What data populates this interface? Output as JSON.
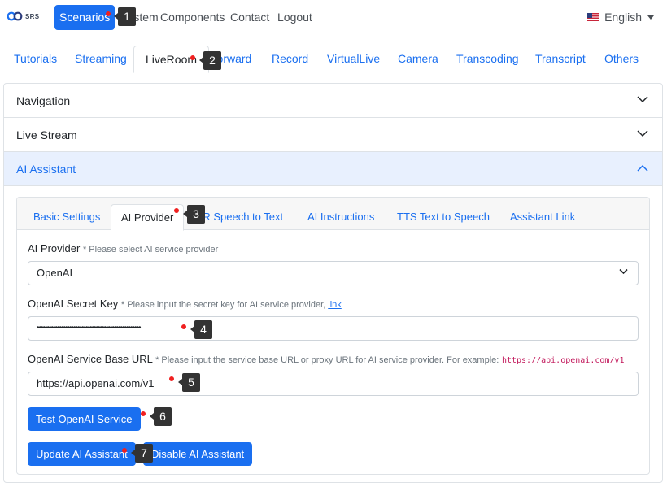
{
  "brand": {
    "text": "SRS",
    "icon": "srs-logo-icon"
  },
  "topnav": {
    "active_label": "Scenarios",
    "links": [
      "System",
      "Components",
      "Contact",
      "Logout"
    ],
    "language": "English",
    "language_icon": "us-flag-icon"
  },
  "main_tabs": [
    "Tutorials",
    "Streaming",
    "LiveRoom",
    "Forward",
    "Record",
    "VirtualLive",
    "Camera",
    "Transcoding",
    "Transcript",
    "Others"
  ],
  "main_tab_active": "LiveRoom",
  "accordion": {
    "sections": [
      "Navigation",
      "Live Stream",
      "AI Assistant"
    ],
    "open": "AI Assistant"
  },
  "card_tabs": [
    "Basic Settings",
    "AI Provider",
    "ASR Speech to Text",
    "AI Instructions",
    "TTS Text to Speech",
    "Assistant Link"
  ],
  "card_tab_active": "AI Provider",
  "form": {
    "provider_label": "AI Provider",
    "provider_hint": "* Please select AI service provider",
    "provider_value": "OpenAI",
    "secret_label": "OpenAI Secret Key",
    "secret_hint": "* Please input the secret key for AI service provider,",
    "secret_link": "link",
    "secret_value": "•••••••••••••••••••••••••••••••••••••••••••••••••••",
    "base_url_label": "OpenAI Service Base URL",
    "base_url_hint": "* Please input the service base URL or proxy URL for AI service provider. For example:",
    "base_url_example": "https://api.openai.com/v1",
    "base_url_value": "https://api.openai.com/v1"
  },
  "buttons": {
    "test": "Test OpenAI Service",
    "update": "Update AI Assistant",
    "disable": "Disable AI Assistant"
  },
  "markers": [
    "1",
    "2",
    "3",
    "4",
    "5",
    "6",
    "7"
  ],
  "colors": {
    "primary": "#1a6ff0",
    "marker_dot": "#f02020",
    "marker_badge": "#333333",
    "open_section_bg": "#e8f0fe"
  }
}
